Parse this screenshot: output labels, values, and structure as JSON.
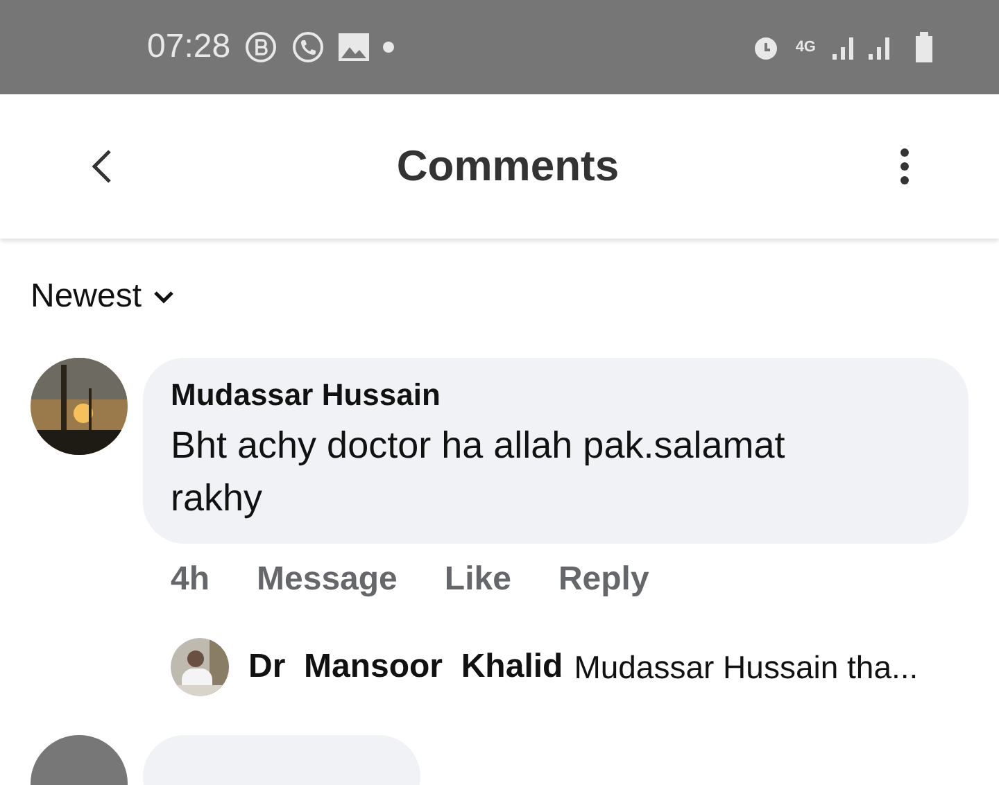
{
  "status_bar": {
    "time": "07:28",
    "network": "4G"
  },
  "header": {
    "title": "Comments"
  },
  "sort": {
    "label": "Newest"
  },
  "comments": [
    {
      "author": "Mudassar Hussain",
      "text": "Bht achy doctor ha allah pak.salamat rakhy",
      "time": "4h",
      "actions": [
        "Message",
        "Like",
        "Reply"
      ],
      "reply": {
        "author": "Dr  Mansoor  Khalid",
        "text": "Mudassar Hussain tha..."
      }
    }
  ]
}
